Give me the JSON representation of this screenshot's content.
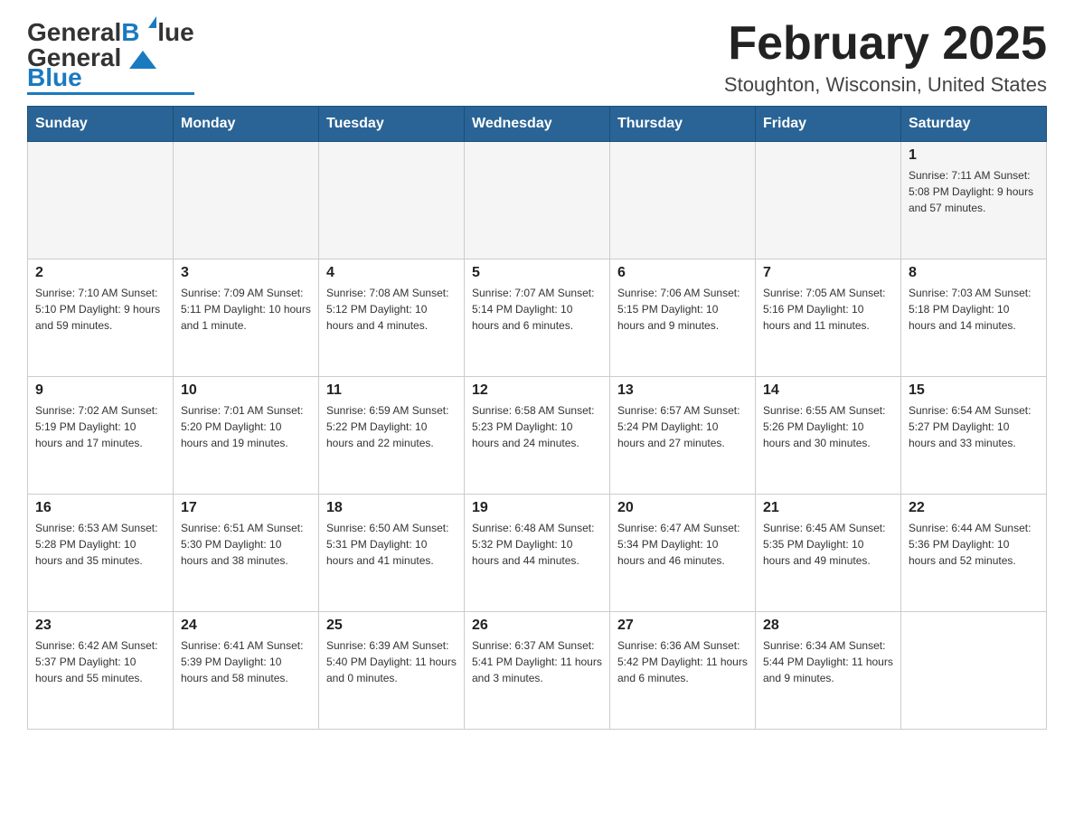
{
  "header": {
    "logo_general": "General",
    "logo_blue": "Blue",
    "title": "February 2025",
    "subtitle": "Stoughton, Wisconsin, United States"
  },
  "weekdays": [
    "Sunday",
    "Monday",
    "Tuesday",
    "Wednesday",
    "Thursday",
    "Friday",
    "Saturday"
  ],
  "weeks": [
    [
      {
        "day": "",
        "info": ""
      },
      {
        "day": "",
        "info": ""
      },
      {
        "day": "",
        "info": ""
      },
      {
        "day": "",
        "info": ""
      },
      {
        "day": "",
        "info": ""
      },
      {
        "day": "",
        "info": ""
      },
      {
        "day": "1",
        "info": "Sunrise: 7:11 AM\nSunset: 5:08 PM\nDaylight: 9 hours and 57 minutes."
      }
    ],
    [
      {
        "day": "2",
        "info": "Sunrise: 7:10 AM\nSunset: 5:10 PM\nDaylight: 9 hours and 59 minutes."
      },
      {
        "day": "3",
        "info": "Sunrise: 7:09 AM\nSunset: 5:11 PM\nDaylight: 10 hours and 1 minute."
      },
      {
        "day": "4",
        "info": "Sunrise: 7:08 AM\nSunset: 5:12 PM\nDaylight: 10 hours and 4 minutes."
      },
      {
        "day": "5",
        "info": "Sunrise: 7:07 AM\nSunset: 5:14 PM\nDaylight: 10 hours and 6 minutes."
      },
      {
        "day": "6",
        "info": "Sunrise: 7:06 AM\nSunset: 5:15 PM\nDaylight: 10 hours and 9 minutes."
      },
      {
        "day": "7",
        "info": "Sunrise: 7:05 AM\nSunset: 5:16 PM\nDaylight: 10 hours and 11 minutes."
      },
      {
        "day": "8",
        "info": "Sunrise: 7:03 AM\nSunset: 5:18 PM\nDaylight: 10 hours and 14 minutes."
      }
    ],
    [
      {
        "day": "9",
        "info": "Sunrise: 7:02 AM\nSunset: 5:19 PM\nDaylight: 10 hours and 17 minutes."
      },
      {
        "day": "10",
        "info": "Sunrise: 7:01 AM\nSunset: 5:20 PM\nDaylight: 10 hours and 19 minutes."
      },
      {
        "day": "11",
        "info": "Sunrise: 6:59 AM\nSunset: 5:22 PM\nDaylight: 10 hours and 22 minutes."
      },
      {
        "day": "12",
        "info": "Sunrise: 6:58 AM\nSunset: 5:23 PM\nDaylight: 10 hours and 24 minutes."
      },
      {
        "day": "13",
        "info": "Sunrise: 6:57 AM\nSunset: 5:24 PM\nDaylight: 10 hours and 27 minutes."
      },
      {
        "day": "14",
        "info": "Sunrise: 6:55 AM\nSunset: 5:26 PM\nDaylight: 10 hours and 30 minutes."
      },
      {
        "day": "15",
        "info": "Sunrise: 6:54 AM\nSunset: 5:27 PM\nDaylight: 10 hours and 33 minutes."
      }
    ],
    [
      {
        "day": "16",
        "info": "Sunrise: 6:53 AM\nSunset: 5:28 PM\nDaylight: 10 hours and 35 minutes."
      },
      {
        "day": "17",
        "info": "Sunrise: 6:51 AM\nSunset: 5:30 PM\nDaylight: 10 hours and 38 minutes."
      },
      {
        "day": "18",
        "info": "Sunrise: 6:50 AM\nSunset: 5:31 PM\nDaylight: 10 hours and 41 minutes."
      },
      {
        "day": "19",
        "info": "Sunrise: 6:48 AM\nSunset: 5:32 PM\nDaylight: 10 hours and 44 minutes."
      },
      {
        "day": "20",
        "info": "Sunrise: 6:47 AM\nSunset: 5:34 PM\nDaylight: 10 hours and 46 minutes."
      },
      {
        "day": "21",
        "info": "Sunrise: 6:45 AM\nSunset: 5:35 PM\nDaylight: 10 hours and 49 minutes."
      },
      {
        "day": "22",
        "info": "Sunrise: 6:44 AM\nSunset: 5:36 PM\nDaylight: 10 hours and 52 minutes."
      }
    ],
    [
      {
        "day": "23",
        "info": "Sunrise: 6:42 AM\nSunset: 5:37 PM\nDaylight: 10 hours and 55 minutes."
      },
      {
        "day": "24",
        "info": "Sunrise: 6:41 AM\nSunset: 5:39 PM\nDaylight: 10 hours and 58 minutes."
      },
      {
        "day": "25",
        "info": "Sunrise: 6:39 AM\nSunset: 5:40 PM\nDaylight: 11 hours and 0 minutes."
      },
      {
        "day": "26",
        "info": "Sunrise: 6:37 AM\nSunset: 5:41 PM\nDaylight: 11 hours and 3 minutes."
      },
      {
        "day": "27",
        "info": "Sunrise: 6:36 AM\nSunset: 5:42 PM\nDaylight: 11 hours and 6 minutes."
      },
      {
        "day": "28",
        "info": "Sunrise: 6:34 AM\nSunset: 5:44 PM\nDaylight: 11 hours and 9 minutes."
      },
      {
        "day": "",
        "info": ""
      }
    ]
  ]
}
